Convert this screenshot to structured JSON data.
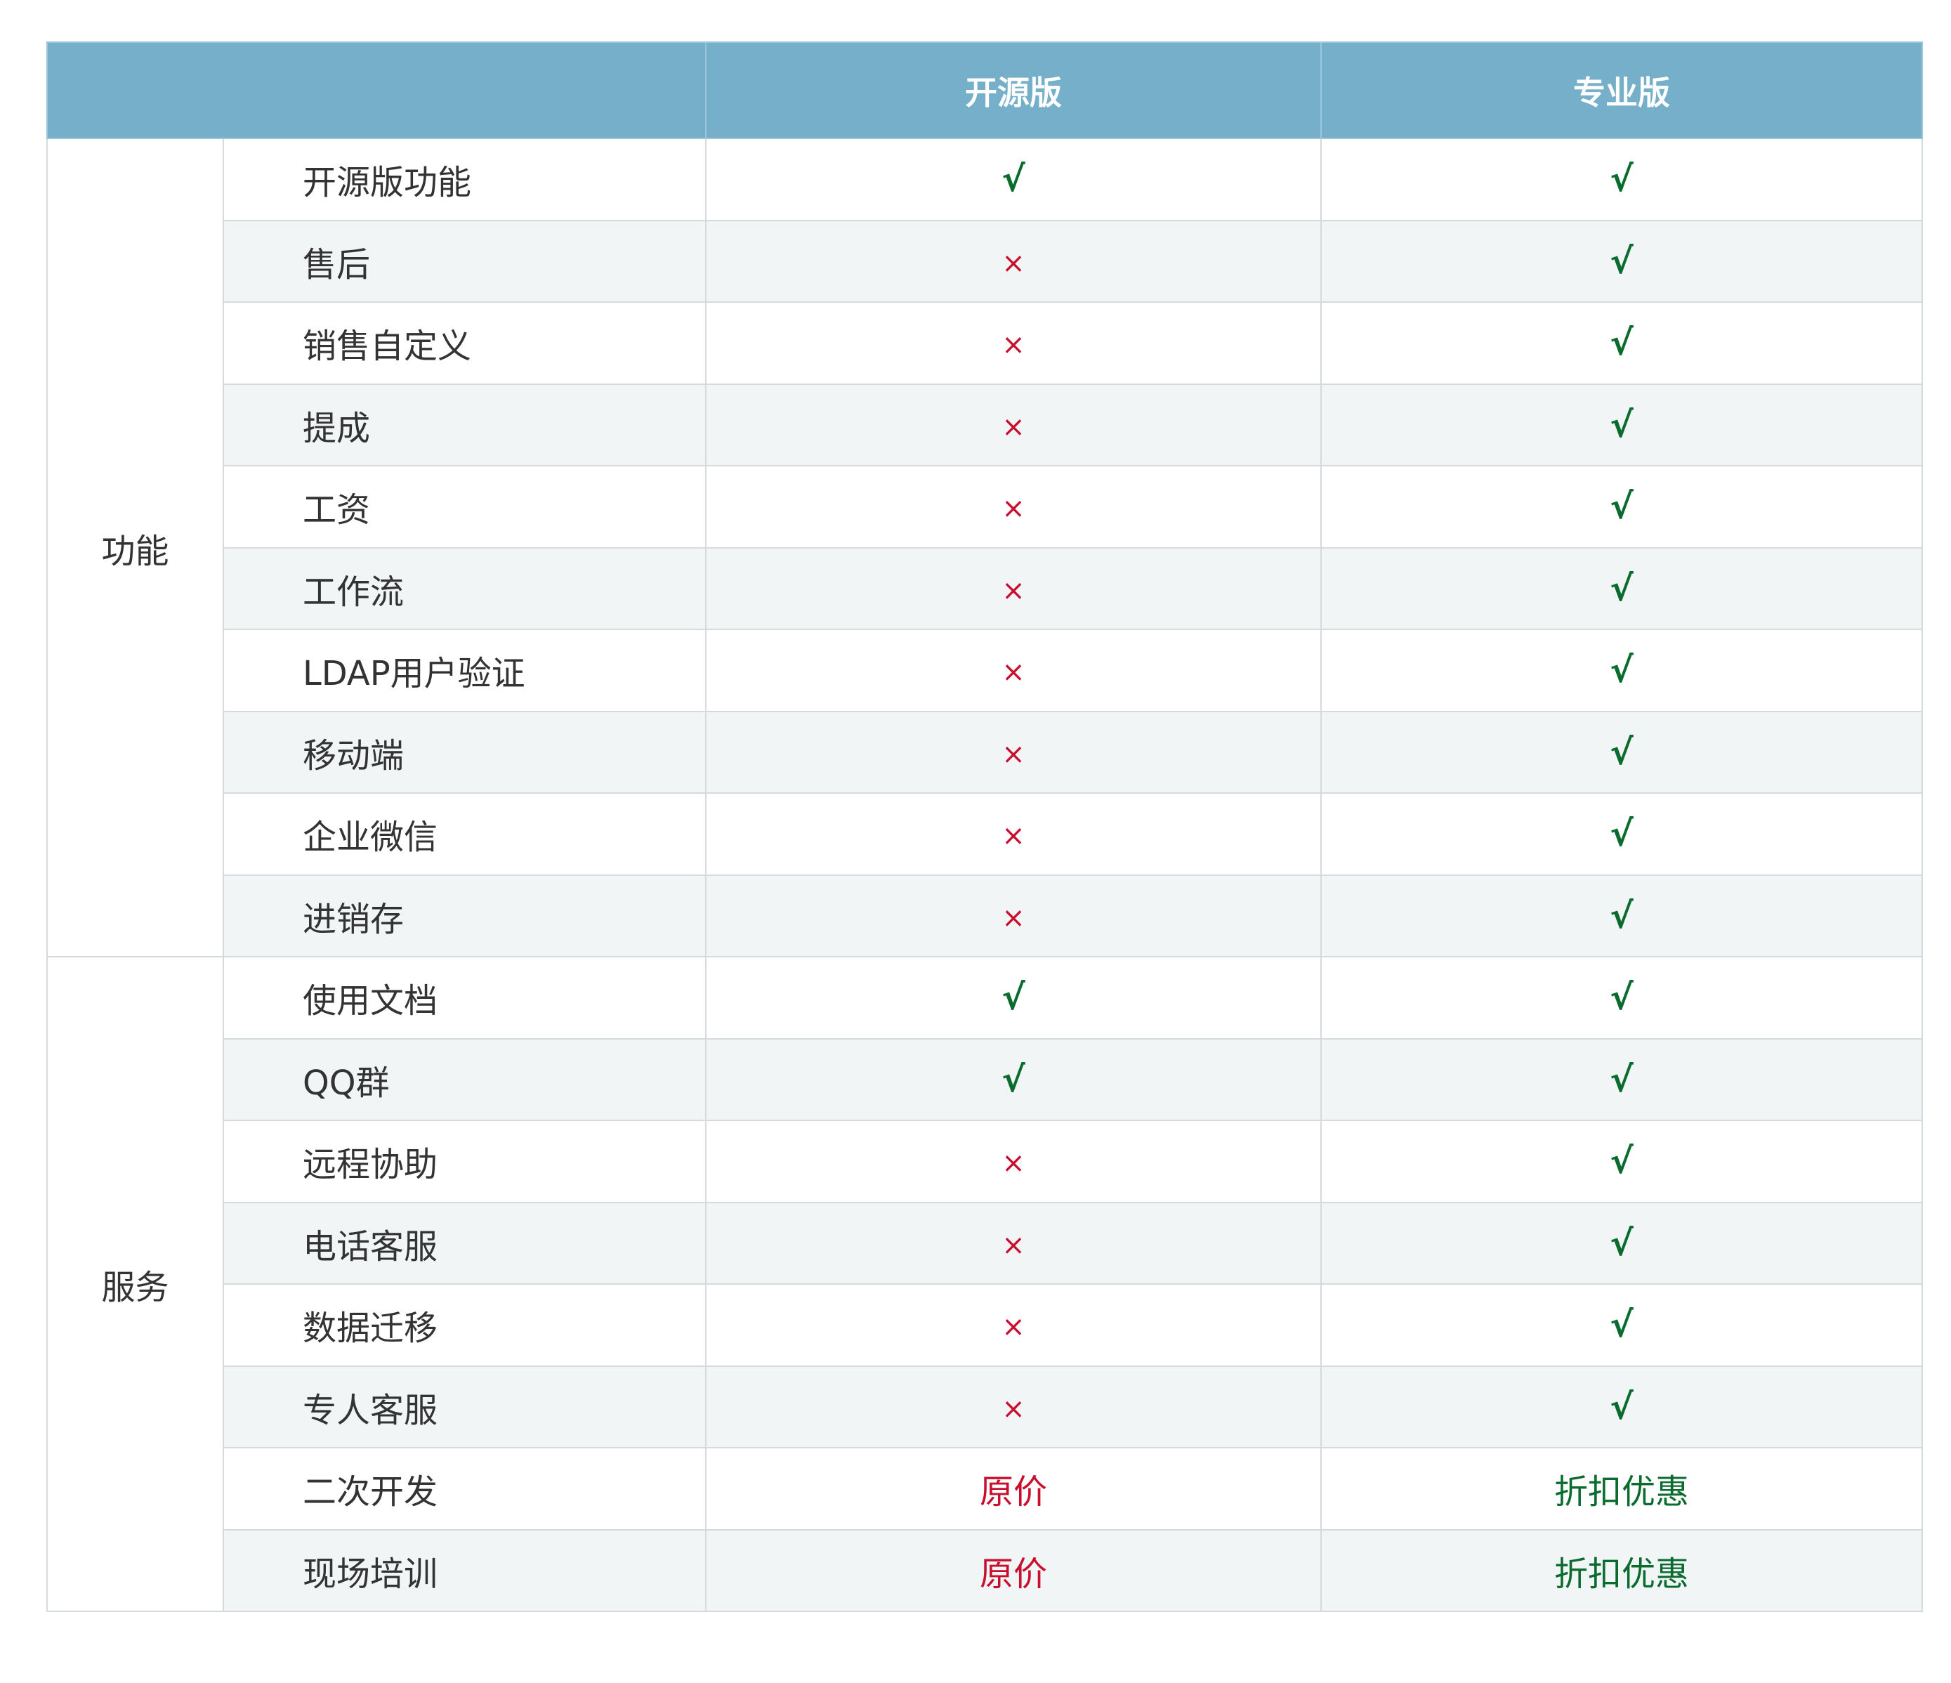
{
  "header": {
    "blank": "",
    "col_open": "开源版",
    "col_pro": "专业版"
  },
  "colors": {
    "header_bg": "#75afc9",
    "yes": "#0a6b2f",
    "no": "#c8102e",
    "stripe": "#f2f5f6"
  },
  "groups": [
    {
      "category": "功能",
      "rows": [
        {
          "feature": "开源版功能",
          "open": {
            "text": "√",
            "kind": "yes"
          },
          "pro": {
            "text": "√",
            "kind": "yes"
          }
        },
        {
          "feature": "售后",
          "open": {
            "text": "×",
            "kind": "no"
          },
          "pro": {
            "text": "√",
            "kind": "yes"
          }
        },
        {
          "feature": "销售自定义",
          "open": {
            "text": "×",
            "kind": "no"
          },
          "pro": {
            "text": "√",
            "kind": "yes"
          }
        },
        {
          "feature": "提成",
          "open": {
            "text": "×",
            "kind": "no"
          },
          "pro": {
            "text": "√",
            "kind": "yes"
          }
        },
        {
          "feature": "工资",
          "open": {
            "text": "×",
            "kind": "no"
          },
          "pro": {
            "text": "√",
            "kind": "yes"
          }
        },
        {
          "feature": "工作流",
          "open": {
            "text": "×",
            "kind": "no"
          },
          "pro": {
            "text": "√",
            "kind": "yes"
          }
        },
        {
          "feature": "LDAP用户验证",
          "open": {
            "text": "×",
            "kind": "no"
          },
          "pro": {
            "text": "√",
            "kind": "yes"
          }
        },
        {
          "feature": "移动端",
          "open": {
            "text": "×",
            "kind": "no"
          },
          "pro": {
            "text": "√",
            "kind": "yes"
          }
        },
        {
          "feature": "企业微信",
          "open": {
            "text": "×",
            "kind": "no"
          },
          "pro": {
            "text": "√",
            "kind": "yes"
          }
        },
        {
          "feature": "进销存",
          "open": {
            "text": "×",
            "kind": "no"
          },
          "pro": {
            "text": "√",
            "kind": "yes"
          }
        }
      ]
    },
    {
      "category": "服务",
      "rows": [
        {
          "feature": "使用文档",
          "open": {
            "text": "√",
            "kind": "yes"
          },
          "pro": {
            "text": "√",
            "kind": "yes"
          }
        },
        {
          "feature": "QQ群",
          "open": {
            "text": "√",
            "kind": "yes"
          },
          "pro": {
            "text": "√",
            "kind": "yes"
          }
        },
        {
          "feature": "远程协助",
          "open": {
            "text": "×",
            "kind": "no"
          },
          "pro": {
            "text": "√",
            "kind": "yes"
          }
        },
        {
          "feature": "电话客服",
          "open": {
            "text": "×",
            "kind": "no"
          },
          "pro": {
            "text": "√",
            "kind": "yes"
          }
        },
        {
          "feature": "数据迁移",
          "open": {
            "text": "×",
            "kind": "no"
          },
          "pro": {
            "text": "√",
            "kind": "yes"
          }
        },
        {
          "feature": "专人客服",
          "open": {
            "text": "×",
            "kind": "no"
          },
          "pro": {
            "text": "√",
            "kind": "yes"
          }
        },
        {
          "feature": "二次开发",
          "open": {
            "text": "原价",
            "kind": "orig"
          },
          "pro": {
            "text": "折扣优惠",
            "kind": "disc"
          }
        },
        {
          "feature": "现场培训",
          "open": {
            "text": "原价",
            "kind": "orig"
          },
          "pro": {
            "text": "折扣优惠",
            "kind": "disc"
          }
        }
      ]
    }
  ]
}
